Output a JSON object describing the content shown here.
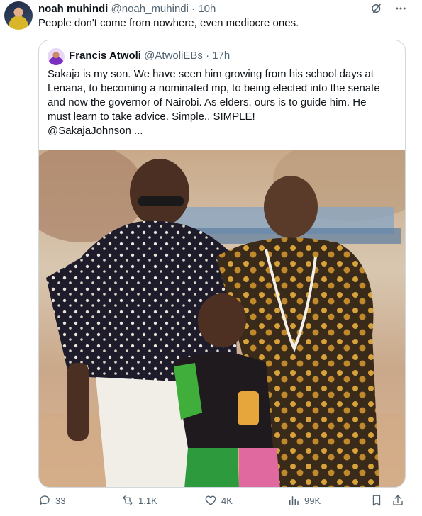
{
  "tweet": {
    "author_name": "noah muhindi",
    "author_handle": "@noah_muhindi",
    "separator": "·",
    "time": "10h",
    "text": "People don't come from nowhere, even mediocre ones."
  },
  "quote": {
    "author_name": "Francis Atwoli",
    "author_handle": "@AtwoliEBs",
    "separator": "·",
    "time": "17h",
    "lines": [
      "Sakaja is my son. We have seen him growing from his school days at",
      "Lenana, to becoming a nominated mp, to being elected into the senate",
      "and now the governor of Nairobi. As elders, ours is to guide him. He",
      "must learn to take advice. Simple.. SIMPLE!",
      "@SakajaJohnson ..."
    ]
  },
  "actions": {
    "replies": "33",
    "reposts": "1.1K",
    "likes": "4K",
    "views": "99K"
  },
  "icons": {
    "top": [
      "grok-icon",
      "more-icon"
    ],
    "actions": [
      "reply-icon",
      "repost-icon",
      "like-icon",
      "views-icon",
      "bookmark-icon",
      "share-icon"
    ]
  },
  "colors": {
    "text": "#0f1419",
    "secondary": "#536471",
    "border": "#cfd9de"
  }
}
